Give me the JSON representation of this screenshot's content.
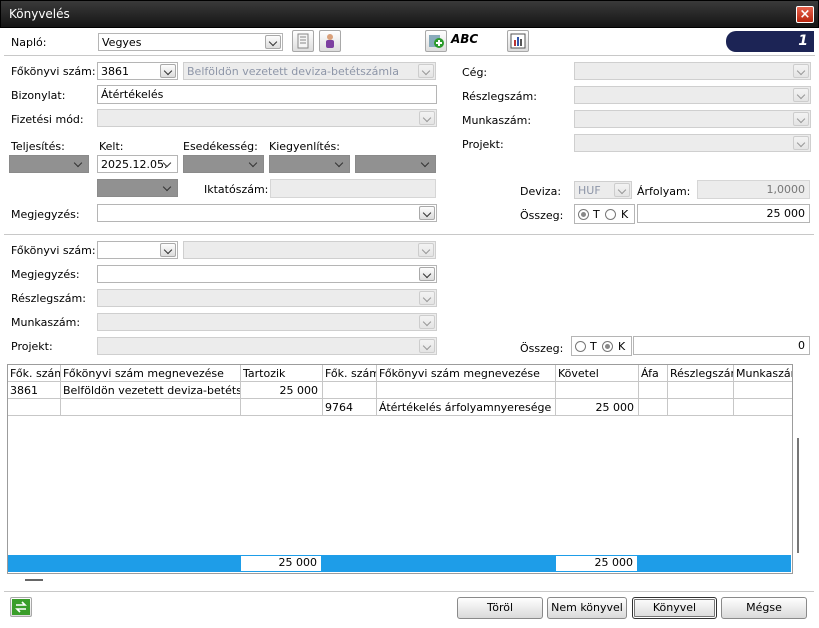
{
  "window": {
    "title": "Könyvelés",
    "close": "×"
  },
  "toolbar": {
    "naplo_label": "Napló:",
    "naplo_value": "Vegyes",
    "abc": "ABC",
    "counter": "1"
  },
  "head": {
    "fokonyv_label": "Főkönyvi szám:",
    "fokonyv_value": "3861",
    "fokonyv_name": "Belföldön vezetett deviza-betétszámla",
    "bizonylat_label": "Bizonylat:",
    "bizonylat_value": "Átértékelés",
    "fizetesi_label": "Fizetési mód:",
    "teljesites_label": "Teljesítés:",
    "kelt_label": "Kelt:",
    "kelt_value": "2025.12.05.",
    "esedekesseg_label": "Esedékesség:",
    "kiegyenlites_label": "Kiegyenlítés:",
    "iktato_label": "Iktatószám:",
    "megjegyzes_label": "Megjegyzés:",
    "ceg_label": "Cég:",
    "reszleg_label": "Részlegszám:",
    "munka_label": "Munkaszám:",
    "projekt_label": "Projekt:",
    "deviza_label": "Deviza:",
    "deviza_value": "HUF",
    "arfolyam_label": "Árfolyam:",
    "arfolyam_value": "1,0000",
    "osszeg_label": "Összeg:",
    "t": "T",
    "k": "K",
    "osszeg_value": "25 000"
  },
  "line": {
    "fokonyv_label": "Főkönyvi szám:",
    "megjegyzes_label": "Megjegyzés:",
    "reszleg_label": "Részlegszám:",
    "munka_label": "Munkaszám:",
    "projekt_label": "Projekt:",
    "osszeg_label": "Összeg:",
    "t": "T",
    "k": "K",
    "osszeg_value": "0"
  },
  "grid": {
    "headers": [
      "Fők. szám",
      "Főkönyvi szám megnevezése",
      "Tartozik",
      "Fők. szám",
      "Főkönyvi szám megnevezése",
      "Követel",
      "Áfa",
      "Részlegszám",
      "Munkaszám"
    ],
    "rows": [
      [
        "3861",
        "Belföldön vezetett deviza-betétszámla",
        "25 000",
        "",
        "",
        "",
        "",
        "",
        ""
      ],
      [
        "",
        "",
        "",
        "9764",
        "Átértékelés árfolyamnyeresége",
        "25 000",
        "",
        "",
        ""
      ]
    ],
    "total_debit": "25 000",
    "total_credit": "25 000"
  },
  "buttons": {
    "torol": "Töröl",
    "nem_konyvel": "Nem könyvel",
    "konyvel": "Könyvel",
    "megse": "Mégse"
  },
  "colors": {
    "titlebar": "#1a1a1a",
    "totals": "#1e9de8",
    "counter": "#1c2455"
  }
}
